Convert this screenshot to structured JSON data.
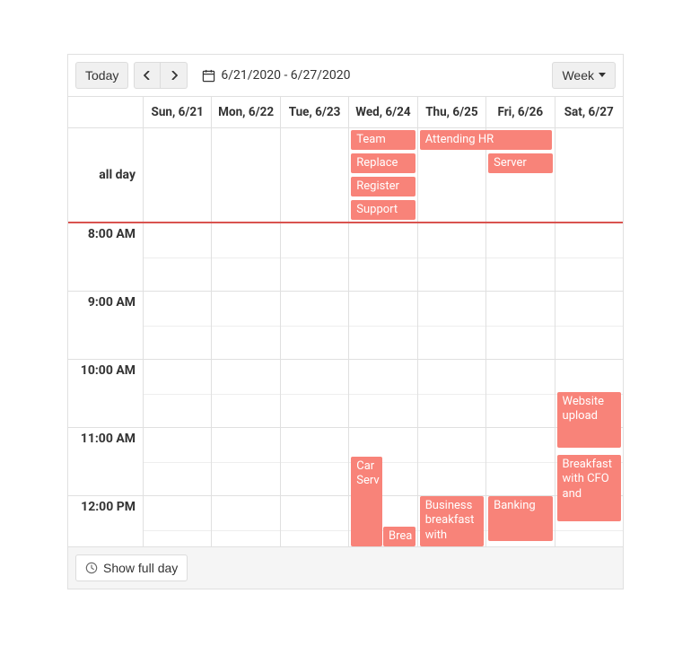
{
  "toolbar": {
    "today": "Today",
    "date_range": "6/21/2020 - 6/27/2020",
    "view": "Week",
    "show_full_day": "Show full day"
  },
  "days": [
    {
      "label": "Sun, 6/21"
    },
    {
      "label": "Mon, 6/22"
    },
    {
      "label": "Tue, 6/23"
    },
    {
      "label": "Wed, 6/24"
    },
    {
      "label": "Thu, 6/25"
    },
    {
      "label": "Fri, 6/26"
    },
    {
      "label": "Sat, 6/27"
    }
  ],
  "allday_label": "all day",
  "allday_events": {
    "wed": [
      {
        "title": "Team"
      },
      {
        "title": "Replace"
      },
      {
        "title": "Register"
      },
      {
        "title": "Support"
      }
    ],
    "thu_fri_span": {
      "title": "Attending HR"
    },
    "fri": [
      {
        "title": "Server"
      }
    ]
  },
  "hours": [
    "8:00 AM",
    "9:00 AM",
    "10:00 AM",
    "11:00 AM",
    "12:00 PM"
  ],
  "timed_events": {
    "wed_1115_car": {
      "title": "Car Serv"
    },
    "wed_1230_brea": {
      "title": "Brea"
    },
    "thu_1145_biz": {
      "title": "Business breakfast with"
    },
    "fri_1145_bank": {
      "title": "Banking"
    },
    "sat_1030_web": {
      "title": "Website upload"
    },
    "sat_1115_cfo": {
      "title": "Breakfast with CFO and"
    }
  }
}
